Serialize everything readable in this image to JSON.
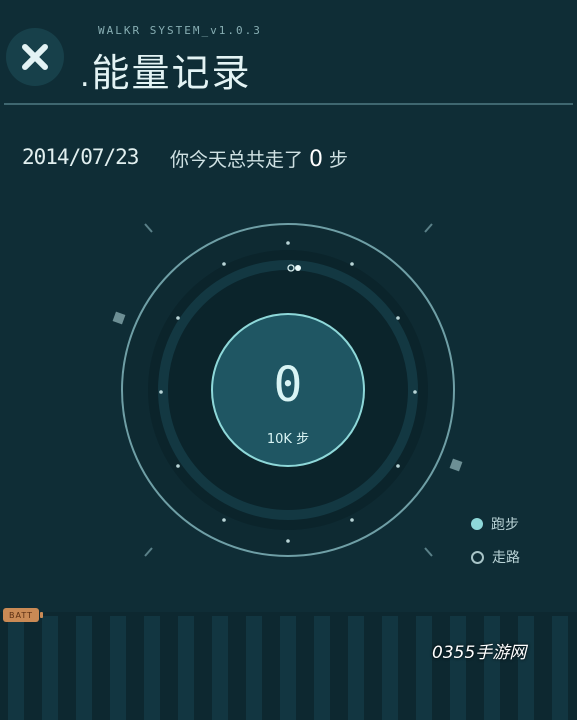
{
  "header": {
    "system_label": "WALKR SYSTEM_v1.0.3",
    "title_prefix": ".",
    "title": "能量记录"
  },
  "summary": {
    "date": "2014/07/23",
    "text_before": "你今天总共走了",
    "steps": "0",
    "text_after": "步"
  },
  "dial": {
    "value": "0",
    "goal_label": "10K 步",
    "progress_fraction": 0
  },
  "legend": {
    "run_label": "跑步",
    "walk_label": "走路"
  },
  "battery": {
    "label": "BATT"
  },
  "watermark": "0355手游网",
  "colors": {
    "background": "#0f2d36",
    "accent": "#8ed8d9",
    "ring": "#6f9fa6",
    "battery": "#c98a55"
  }
}
